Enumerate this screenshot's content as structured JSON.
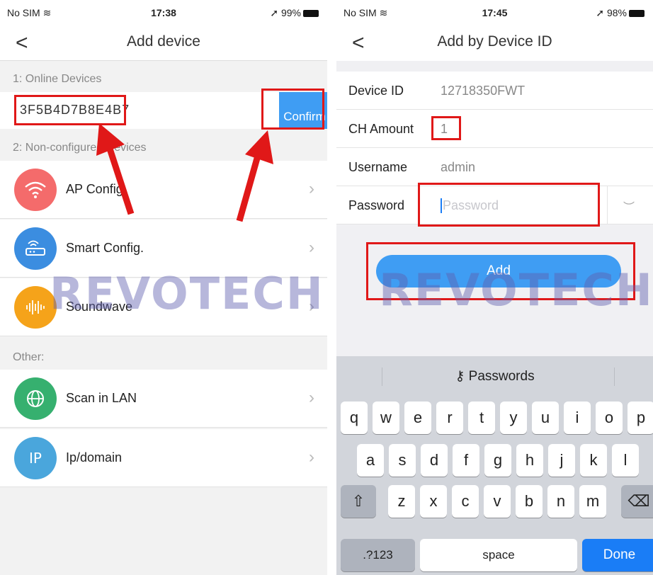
{
  "left": {
    "status": {
      "carrier": "No SIM",
      "time": "17:38",
      "battery": "99%"
    },
    "nav": {
      "back": "<",
      "title": "Add device"
    },
    "online_label": "1: Online Devices",
    "device_id": "3F5B4D7B8E4B7",
    "confirm_label": "Confirm",
    "nonconfig_label": "2: Non-configured Devices",
    "options": [
      {
        "label": "AP Config.",
        "icon": "wifi-icon",
        "color": "#f46b6b"
      },
      {
        "label": "Smart Config.",
        "icon": "router-icon",
        "color": "#3b8de0"
      },
      {
        "label": "Soundwave",
        "icon": "soundwave-icon",
        "color": "#f5a31a"
      }
    ],
    "other_label": "Other:",
    "other_options": [
      {
        "label": "Scan in LAN",
        "icon": "globe-icon",
        "color": "#36b06f"
      },
      {
        "label": "Ip/domain",
        "icon": "ip-icon",
        "color": "#4aa6dc"
      }
    ],
    "ip_icon_text": "IP"
  },
  "right": {
    "status": {
      "carrier": "No SIM",
      "time": "17:45",
      "battery": "98%"
    },
    "nav": {
      "back": "<",
      "title": "Add by Device ID"
    },
    "fields": {
      "device_id_label": "Device ID",
      "device_id_value": "12718350FWT",
      "ch_label": "CH Amount",
      "ch_value": "1",
      "username_label": "Username",
      "username_value": "admin",
      "password_label": "Password",
      "password_placeholder": "Password"
    },
    "add_label": "Add",
    "keyboard": {
      "bar_label": "Passwords",
      "row1": [
        "q",
        "w",
        "e",
        "r",
        "t",
        "y",
        "u",
        "i",
        "o",
        "p"
      ],
      "row2": [
        "a",
        "s",
        "d",
        "f",
        "g",
        "h",
        "j",
        "k",
        "l"
      ],
      "row3": [
        "z",
        "x",
        "c",
        "v",
        "b",
        "n",
        "m"
      ],
      "numbers_label": ".?123",
      "space_label": "space",
      "done_label": "Done"
    }
  },
  "watermark": "REVOTECH",
  "colors": {
    "accent": "#3f9df3",
    "highlight": "#e01818"
  }
}
